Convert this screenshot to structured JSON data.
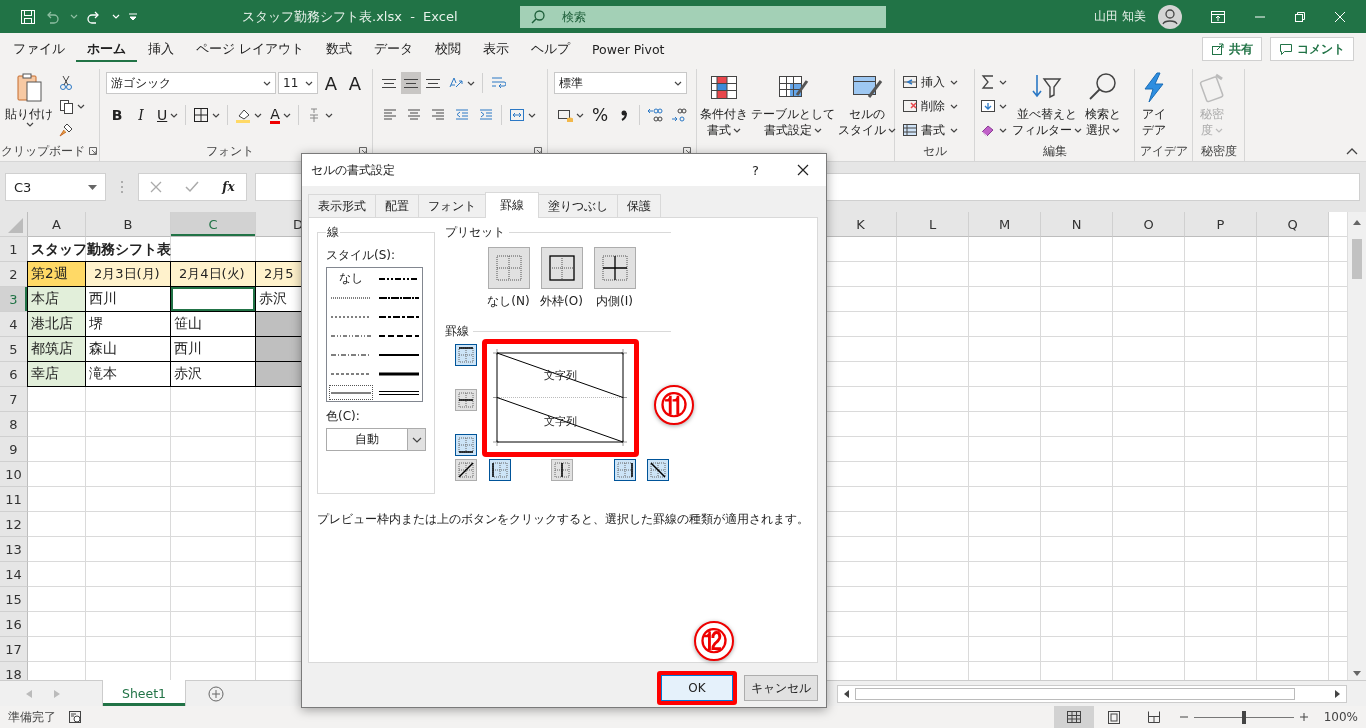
{
  "title_bar": {
    "title": "スタッフ勤務シフト表.xlsx  -  Excel",
    "search_placeholder": "検索",
    "user_name": "山田 知美"
  },
  "ribbon_tabs": [
    {
      "label": "ファイル",
      "selected": false
    },
    {
      "label": "ホーム",
      "selected": true
    },
    {
      "label": "挿入",
      "selected": false
    },
    {
      "label": "ページ レイアウト",
      "selected": false
    },
    {
      "label": "数式",
      "selected": false
    },
    {
      "label": "データ",
      "selected": false
    },
    {
      "label": "校閲",
      "selected": false
    },
    {
      "label": "表示",
      "selected": false
    },
    {
      "label": "ヘルプ",
      "selected": false
    },
    {
      "label": "Power Pivot",
      "selected": false
    }
  ],
  "share_button": "共有",
  "comment_button": "コメント",
  "ribbon_groups": [
    {
      "kind": "clipboard",
      "label": "クリップボード",
      "paste_label": "貼り付け"
    },
    {
      "kind": "font",
      "label": "フォント",
      "font_name": "游ゴシック",
      "font_size": "11",
      "grow_font": "A",
      "shrink_font": "A",
      "bold": "B",
      "italic": "I",
      "underline": "U",
      "font_color": "A"
    },
    {
      "kind": "alignment",
      "vertical_align": [
        {
          "selected": false
        },
        {
          "selected": true
        },
        {
          "selected": false
        }
      ]
    },
    {
      "kind": "number",
      "format": "標準",
      "percent": "%"
    },
    {
      "kind": "buttons",
      "buttons": [
        {
          "kind": "conditional",
          "lines": [
            "条件付き",
            "書式"
          ],
          "dropdown": true,
          "disabled": false
        },
        {
          "kind": "table",
          "lines": [
            "テーブルとして",
            "書式設定"
          ],
          "dropdown": true,
          "disabled": false
        },
        {
          "kind": "cellstyle",
          "lines": [
            "セルの",
            "スタイル"
          ],
          "dropdown": true,
          "disabled": false
        }
      ]
    },
    {
      "kind": "cells",
      "label": "セル",
      "items": [
        "挿入",
        "削除",
        "書式"
      ]
    },
    {
      "kind": "editing",
      "label": "編集",
      "buttons": [
        {
          "kind": "sort",
          "lines": [
            "並べ替えと",
            "フィルター"
          ],
          "dropdown": true,
          "disabled": false
        },
        {
          "kind": "find",
          "lines": [
            "検索と",
            "選択"
          ],
          "dropdown": true,
          "disabled": false
        }
      ]
    },
    {
      "kind": "buttons",
      "label": "アイデア",
      "buttons": [
        {
          "kind": "ideas",
          "lines": [
            "アイ",
            "デア"
          ],
          "dropdown": false,
          "disabled": false
        }
      ]
    },
    {
      "kind": "buttons",
      "label": "秘密度",
      "buttons": [
        {
          "kind": "sensitivity",
          "lines": [
            "秘密",
            "度"
          ],
          "dropdown": true,
          "disabled": true
        }
      ]
    }
  ],
  "formula_bar": {
    "name_box": "C3",
    "function_label": "fx"
  },
  "sheet": {
    "columns_left": [
      {
        "label": "A",
        "selected": false
      },
      {
        "label": "B",
        "selected": false
      },
      {
        "label": "C",
        "selected": true
      },
      {
        "label": "D",
        "selected": false
      }
    ],
    "columns_right": [
      {
        "label": "K",
        "selected": false
      },
      {
        "label": "L",
        "selected": false
      },
      {
        "label": "M",
        "selected": false
      },
      {
        "label": "N",
        "selected": false
      },
      {
        "label": "O",
        "selected": false
      },
      {
        "label": "P",
        "selected": false
      },
      {
        "label": "Q",
        "selected": false
      }
    ],
    "rows": [
      {
        "number": "1",
        "selected": false,
        "cells": [
          {
            "kind": "title",
            "text": "スタッフ勤務シフト表",
            "selected": false
          }
        ]
      },
      {
        "number": "2",
        "selected": false,
        "cells": [
          {
            "kind": "week",
            "text": "第2週",
            "selected": false
          },
          {
            "kind": "date",
            "text": "2月3日(月)",
            "selected": false
          },
          {
            "kind": "date",
            "text": "2月4日(火)",
            "selected": false
          },
          {
            "kind": "date",
            "text": "2月5",
            "selected": false
          }
        ]
      },
      {
        "number": "3",
        "selected": true,
        "cells": [
          {
            "kind": "store",
            "text": "本店",
            "selected": false
          },
          {
            "kind": "name",
            "text": "西川",
            "selected": false
          },
          {
            "kind": "name",
            "selected": true
          },
          {
            "kind": "name",
            "text": "赤沢",
            "selected": false
          }
        ]
      },
      {
        "number": "4",
        "selected": false,
        "cells": [
          {
            "kind": "store",
            "text": "港北店",
            "selected": false
          },
          {
            "kind": "name",
            "text": "堺",
            "selected": false
          },
          {
            "kind": "name",
            "text": "笹山",
            "selected": false
          },
          {
            "kind": "shaded",
            "selected": false
          }
        ]
      },
      {
        "number": "5",
        "selected": false,
        "cells": [
          {
            "kind": "store",
            "text": "都筑店",
            "selected": false
          },
          {
            "kind": "name",
            "text": "森山",
            "selected": false
          },
          {
            "kind": "name",
            "text": "西川",
            "selected": false
          },
          {
            "kind": "shaded",
            "selected": false
          }
        ]
      },
      {
        "number": "6",
        "selected": false,
        "cells": [
          {
            "kind": "store",
            "text": "幸店",
            "selected": false
          },
          {
            "kind": "name",
            "text": "滝本",
            "selected": false
          },
          {
            "kind": "name",
            "text": "赤沢",
            "selected": false
          },
          {
            "kind": "shaded",
            "selected": false
          }
        ]
      },
      {
        "number": "7",
        "selected": false
      },
      {
        "number": "8",
        "selected": false
      },
      {
        "number": "9",
        "selected": false
      },
      {
        "number": "10",
        "selected": false
      },
      {
        "number": "11",
        "selected": false
      },
      {
        "number": "12",
        "selected": false
      },
      {
        "number": "13",
        "selected": false
      },
      {
        "number": "14",
        "selected": false
      },
      {
        "number": "15",
        "selected": false
      },
      {
        "number": "16",
        "selected": false
      },
      {
        "number": "17",
        "selected": false
      },
      {
        "number": "18",
        "selected": false
      }
    ]
  },
  "sheet_tabs": [
    {
      "label": "Sheet1",
      "selected": true
    }
  ],
  "status_bar": {
    "text": "準備完了",
    "views": [
      {
        "kind": "normal",
        "selected": true
      },
      {
        "kind": "page_layout",
        "selected": false
      },
      {
        "kind": "page_break",
        "selected": false
      }
    ],
    "zoom": {
      "level": 0.5
    },
    "zoom_text": "100%"
  },
  "dialog": {
    "title": "セルの書式設定",
    "help": "?",
    "tabs": [
      {
        "label": "表示形式",
        "selected": false
      },
      {
        "label": "配置",
        "selected": false
      },
      {
        "label": "フォント",
        "selected": false
      },
      {
        "label": "罫線",
        "selected": true
      },
      {
        "label": "塗りつぶし",
        "selected": false
      },
      {
        "label": "保護",
        "selected": false
      }
    ],
    "line_label": "線",
    "style_label": "スタイル(S):",
    "styles": [
      {
        "kind": "none",
        "label": "なし",
        "selected": false
      },
      {
        "kind": "hair",
        "selected": false
      },
      {
        "kind": "dotted",
        "selected": false
      },
      {
        "kind": "dash_dot_dot",
        "selected": false
      },
      {
        "kind": "dash_dot",
        "selected": false
      },
      {
        "kind": "dashed",
        "selected": false
      },
      {
        "kind": "thin",
        "selected": true
      },
      {
        "kind": "medium_dash_dot_dot",
        "selected": false
      },
      {
        "kind": "slant_dash_dot",
        "selected": false
      },
      {
        "kind": "medium_dash_dot",
        "selected": false
      },
      {
        "kind": "medium_dashed",
        "selected": false
      },
      {
        "kind": "medium",
        "selected": false
      },
      {
        "kind": "thick",
        "selected": false
      },
      {
        "kind": "double",
        "selected": false
      }
    ],
    "color_label": "色(C):",
    "color_value": "自動",
    "preset_label": "プリセット",
    "presets": [
      {
        "kind": "none",
        "label": "なし(N)"
      },
      {
        "kind": "outline",
        "label": "外枠(O)"
      },
      {
        "kind": "inside",
        "label": "内側(I)"
      }
    ],
    "border_label": "罫線",
    "border_buttons": [
      {
        "kind": "top",
        "on": true
      },
      {
        "kind": "middle",
        "on": false
      },
      {
        "kind": "bottom",
        "on": true
      },
      {
        "kind": "diagonal_up",
        "on": false
      },
      {
        "kind": "left",
        "on": true
      },
      {
        "kind": "center",
        "on": false
      },
      {
        "kind": "right",
        "on": true
      },
      {
        "kind": "diagonal_down",
        "on": true
      }
    ],
    "preview_texts": [
      "文字列",
      "文字列"
    ],
    "hint": "プレビュー枠内または上のボタンをクリックすると、選択した罫線の種類が適用されます。",
    "buttons": [
      {
        "label": "OK",
        "kind": "ok"
      },
      {
        "label": "キャンセル",
        "kind": "cancel"
      }
    ]
  },
  "step_marks": [
    {
      "label": "⑪"
    },
    {
      "label": "⑫"
    }
  ]
}
